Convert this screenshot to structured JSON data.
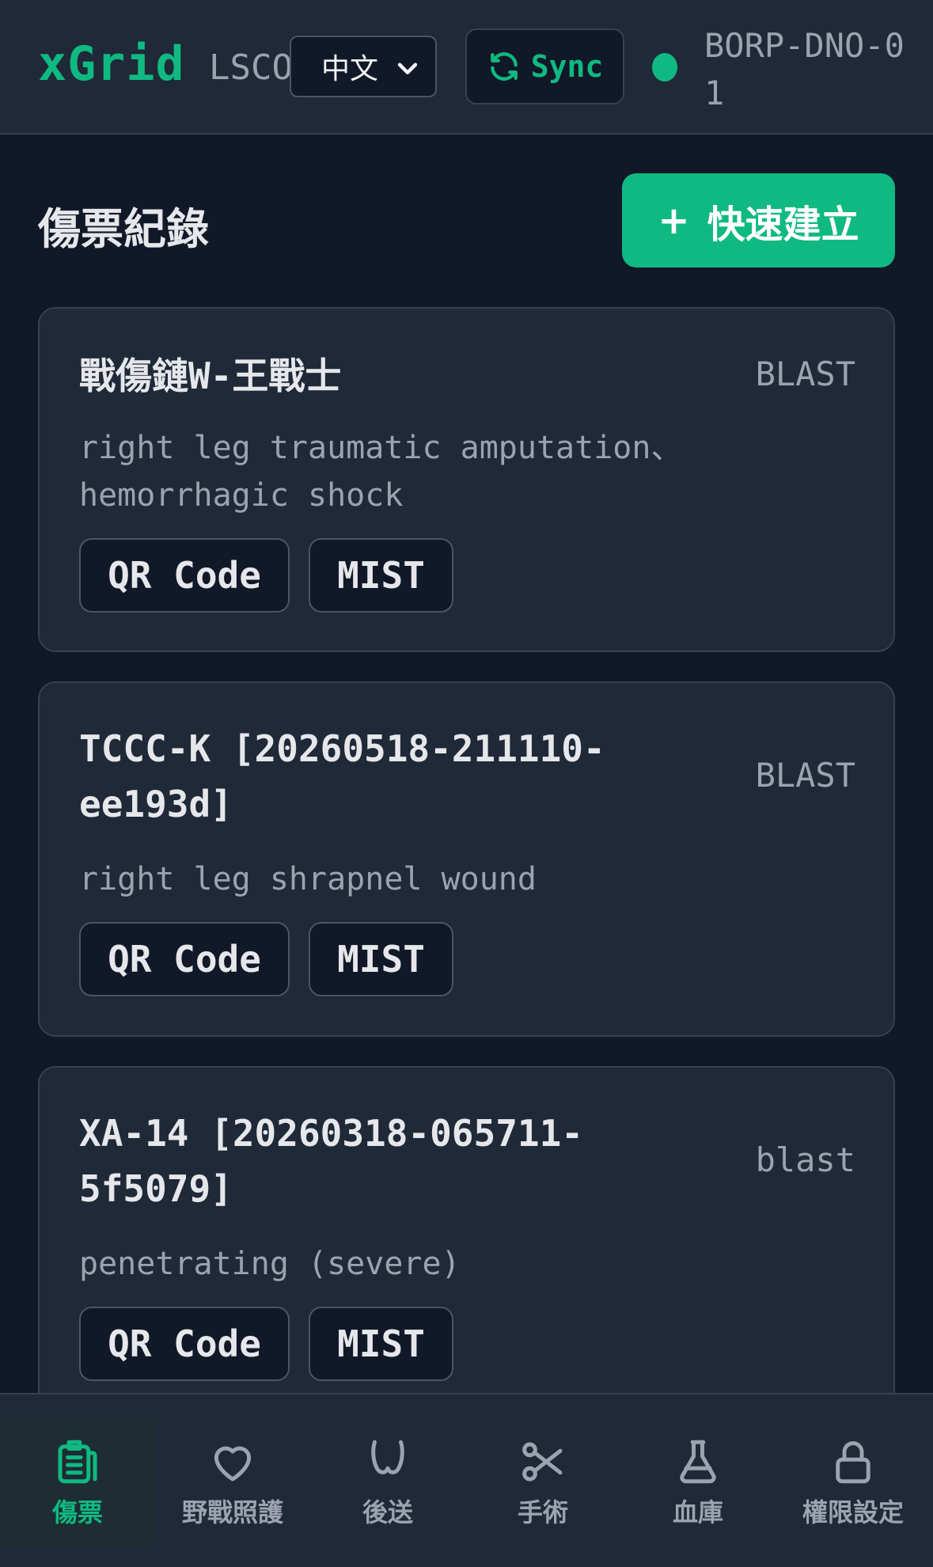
{
  "header": {
    "brand": "xGrid",
    "site": "LSCO",
    "language": "中文",
    "sync_label": "Sync",
    "device_id": "BORP-DNO-01",
    "status_color": "#10b981"
  },
  "page": {
    "title": "傷票紀錄",
    "quick_create_icon": "+",
    "quick_create_label": "快速建立"
  },
  "records": [
    {
      "title": "戰傷鏈W-王戰士",
      "type": "BLAST",
      "description": "right leg traumatic amputation、hemorrhagic shock",
      "qr_label": "QR Code",
      "mist_label": "MIST"
    },
    {
      "title": "TCCC-K [20260518-211110-ee193d]",
      "type": "BLAST",
      "description": "right leg shrapnel wound",
      "qr_label": "QR Code",
      "mist_label": "MIST"
    },
    {
      "title": "XA-14 [20260318-065711-5f5079]",
      "type": "blast",
      "description": "penetrating (severe)",
      "qr_label": "QR Code",
      "mist_label": "MIST"
    }
  ],
  "nav": [
    {
      "label": "傷票",
      "icon": "clipboard-icon",
      "active": true
    },
    {
      "label": "野戰照護",
      "icon": "heart-icon",
      "active": false
    },
    {
      "label": "後送",
      "icon": "stretcher-icon",
      "active": false
    },
    {
      "label": "手術",
      "icon": "scissors-icon",
      "active": false
    },
    {
      "label": "血庫",
      "icon": "flask-icon",
      "active": false
    },
    {
      "label": "權限設定",
      "icon": "lock-icon",
      "active": false
    }
  ],
  "colors": {
    "accent": "#10b981",
    "background": "#111827",
    "surface": "#1f2937"
  }
}
